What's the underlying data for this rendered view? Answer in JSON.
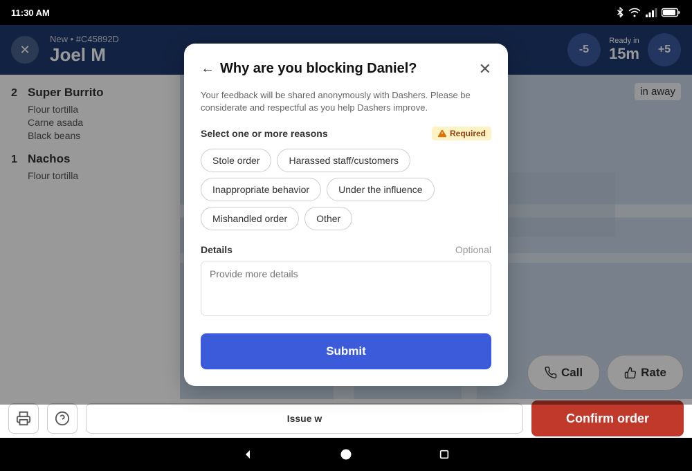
{
  "statusBar": {
    "time": "11:30 AM"
  },
  "header": {
    "subtitle": "New • #C45892D",
    "title": "Joel M",
    "counterMinus": "-5",
    "readyInLabel": "Ready in",
    "readyInValue": "15m",
    "counterPlus": "+5"
  },
  "orderList": {
    "items": [
      {
        "qty": "2",
        "name": "Super Burrito",
        "modifiers": [
          "Flour tortilla",
          "Carne asada",
          "Black beans"
        ]
      },
      {
        "qty": "1",
        "name": "Nachos",
        "modifiers": [
          "Flour tortilla"
        ]
      }
    ]
  },
  "map": {
    "inAwayText": "in away"
  },
  "actionButtons": {
    "callLabel": "Call",
    "rateLabel": "Rate"
  },
  "bottomBar": {
    "issueLabel": "Issue w",
    "confirmLabel": "Confirm order"
  },
  "modal": {
    "title": "Why are you blocking Daniel?",
    "subtitle": "Your feedback will be shared anonymously with Dashers. Please be considerate and respectful as you help Dashers improve.",
    "sectionLabel": "Select one or more reasons",
    "requiredLabel": "Required",
    "reasons": [
      "Stole order",
      "Harassed staff/customers",
      "Inappropriate behavior",
      "Under the influence",
      "Mishandled order",
      "Other"
    ],
    "detailsLabel": "Details",
    "detailsOptional": "Optional",
    "detailsPlaceholder": "Provide more details",
    "submitLabel": "Submit"
  }
}
